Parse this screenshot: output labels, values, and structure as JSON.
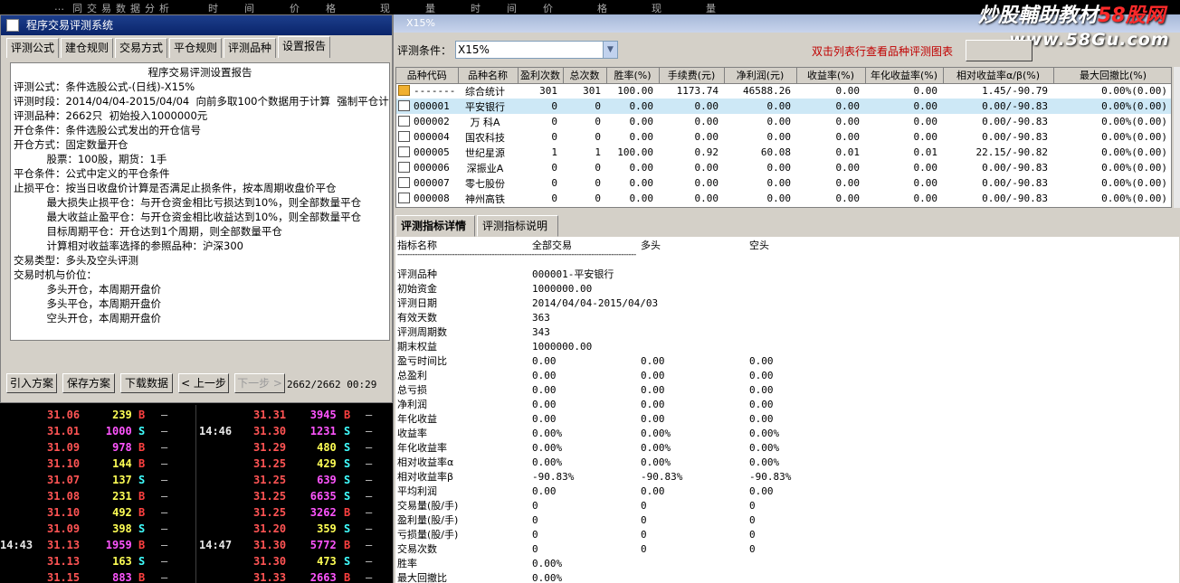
{
  "top_strip": [
    "…",
    "同",
    "交",
    "易",
    "数",
    "据",
    "分",
    "析",
    "时",
    "间",
    "价",
    "格",
    "现",
    "量",
    "时",
    "间",
    "价",
    "格",
    "现",
    "量"
  ],
  "left_dialog": {
    "title": "程序交易评测系统",
    "tabs": [
      "评测公式",
      "建仓规则",
      "交易方式",
      "平仓规则",
      "评测品种",
      "设置报告"
    ],
    "active_tab": "设置报告",
    "report_title": "程序交易评测设置报告",
    "report_lines": [
      "评测公式：条件选股公式-(日线)-X15%",
      "评测时段：2014/04/04-2015/04/04  向前多取100个数据用于计算  强制平仓计入",
      "评测品种：2662只  初始投入1000000元",
      "开仓条件：条件选股公式发出的开仓信号",
      "开仓方式：固定数量开仓",
      "          股票：100股，期货：1手",
      "平仓条件：公式中定义的平仓条件",
      "止损平仓：按当日收盘价计算是否满足止损条件，按本周期收盘价平仓",
      "          最大损失止损平仓：与开仓资金相比亏损达到10%，则全部数量平仓",
      "          最大收益止盈平仓：与开仓资金相比收益达到10%，则全部数量平仓",
      "          目标周期平仓：开仓达到1个周期，则全部数量平仓",
      "          计算相对收益率选择的参照品种：沪深300",
      "",
      "交易类型：多头及空头评测",
      "交易时机与价位：",
      "          多头开仓，本周期开盘价",
      "          多头平仓，本周期开盘价",
      "          空头开仓，本周期开盘价"
    ],
    "buttons": [
      "引入方案",
      "保存方案",
      "下载数据",
      "< 上一步",
      "下一步 >"
    ],
    "counter": "2662/2662  00:29"
  },
  "tape": {
    "times": [
      "",
      "",
      "",
      "",
      "",
      "",
      "",
      "",
      "14:43",
      "",
      ""
    ],
    "times2": [
      "",
      "14:46",
      "",
      "",
      "",
      "",
      "",
      "",
      "14:47",
      "",
      ""
    ],
    "left": [
      {
        "price": "31.06",
        "vol": "239",
        "bs": "B",
        "vc": "y"
      },
      {
        "price": "31.01",
        "vol": "1000",
        "bs": "S",
        "vc": "p"
      },
      {
        "price": "31.09",
        "vol": "978",
        "bs": "B",
        "vc": "p"
      },
      {
        "price": "31.10",
        "vol": "144",
        "bs": "B",
        "vc": "y"
      },
      {
        "price": "31.07",
        "vol": "137",
        "bs": "S",
        "vc": "y"
      },
      {
        "price": "31.08",
        "vol": "231",
        "bs": "B",
        "vc": "y"
      },
      {
        "price": "31.10",
        "vol": "492",
        "bs": "B",
        "vc": "y"
      },
      {
        "price": "31.09",
        "vol": "398",
        "bs": "S",
        "vc": "y"
      },
      {
        "price": "31.13",
        "vol": "1959",
        "bs": "B",
        "vc": "p"
      },
      {
        "price": "31.13",
        "vol": "163",
        "bs": "S",
        "vc": "y"
      },
      {
        "price": "31.15",
        "vol": "883",
        "bs": "B",
        "vc": "p"
      }
    ],
    "right": [
      {
        "price": "31.31",
        "vol": "3945",
        "bs": "B",
        "vc": "p"
      },
      {
        "price": "31.30",
        "vol": "1231",
        "bs": "S",
        "vc": "p"
      },
      {
        "price": "31.29",
        "vol": "480",
        "bs": "S",
        "vc": "y"
      },
      {
        "price": "31.25",
        "vol": "429",
        "bs": "S",
        "vc": "y"
      },
      {
        "price": "31.25",
        "vol": "639",
        "bs": "S",
        "vc": "p"
      },
      {
        "price": "31.25",
        "vol": "6635",
        "bs": "S",
        "vc": "p"
      },
      {
        "price": "31.25",
        "vol": "3262",
        "bs": "B",
        "vc": "p"
      },
      {
        "price": "31.20",
        "vol": "359",
        "bs": "S",
        "vc": "y"
      },
      {
        "price": "31.30",
        "vol": "5772",
        "bs": "B",
        "vc": "p"
      },
      {
        "price": "31.30",
        "vol": "473",
        "bs": "S",
        "vc": "y"
      },
      {
        "price": "31.33",
        "vol": "2663",
        "bs": "B",
        "vc": "p"
      }
    ],
    "dash": "—"
  },
  "right_window": {
    "title": "X15%",
    "watermark_line1": "炒股輔助教材",
    "watermark_brand": "58股网",
    "watermark_line2": "www.58Gu.com",
    "cond_label": "评测条件：",
    "cond_value": "X15%",
    "hint": "双击列表行查看品种评测图表",
    "columns": [
      "品种代码",
      "品种名称",
      "盈利次数",
      "总次数",
      "胜率(%)",
      "手续费(元)",
      "净利润(元)",
      "收益率(%)",
      "年化收益率(%)",
      "相对收益率α/β(%)",
      "最大回撤比(%)"
    ],
    "rows": [
      [
        "-------",
        "综合统计",
        "301",
        "301",
        "100.00",
        "1173.74",
        "46588.26",
        "0.00",
        "0.00",
        "1.45/-90.79",
        "0.00%(0.00)"
      ],
      [
        "000001",
        "平安银行",
        "0",
        "0",
        "0.00",
        "0.00",
        "0.00",
        "0.00",
        "0.00",
        "0.00/-90.83",
        "0.00%(0.00)"
      ],
      [
        "000002",
        "万  科A",
        "0",
        "0",
        "0.00",
        "0.00",
        "0.00",
        "0.00",
        "0.00",
        "0.00/-90.83",
        "0.00%(0.00)"
      ],
      [
        "000004",
        "国农科技",
        "0",
        "0",
        "0.00",
        "0.00",
        "0.00",
        "0.00",
        "0.00",
        "0.00/-90.83",
        "0.00%(0.00)"
      ],
      [
        "000005",
        "世纪星源",
        "1",
        "1",
        "100.00",
        "0.92",
        "60.08",
        "0.01",
        "0.01",
        "22.15/-90.82",
        "0.00%(0.00)"
      ],
      [
        "000006",
        "深振业A",
        "0",
        "0",
        "0.00",
        "0.00",
        "0.00",
        "0.00",
        "0.00",
        "0.00/-90.83",
        "0.00%(0.00)"
      ],
      [
        "000007",
        "零七股份",
        "0",
        "0",
        "0.00",
        "0.00",
        "0.00",
        "0.00",
        "0.00",
        "0.00/-90.83",
        "0.00%(0.00)"
      ],
      [
        "000008",
        "神州高铁",
        "0",
        "0",
        "0.00",
        "0.00",
        "0.00",
        "0.00",
        "0.00",
        "0.00/-90.83",
        "0.00%(0.00)"
      ]
    ],
    "selected_row": 1,
    "lower_tabs": [
      "评测指标详情",
      "评测指标说明"
    ],
    "detail_header": [
      "指标名称",
      "全部交易",
      "多头",
      "空头"
    ],
    "detail_rule": "------------------------------------------------------------------------------------------------",
    "detail_rows": [
      [
        "评测品种",
        "000001-平安银行",
        "",
        ""
      ],
      [
        "初始资金",
        "1000000.00",
        "",
        ""
      ],
      [
        "评测日期",
        "2014/04/04-2015/04/03",
        "",
        ""
      ],
      [
        "有效天数",
        "363",
        "",
        ""
      ],
      [
        "评测周期数",
        "343",
        "",
        ""
      ],
      [
        "期末权益",
        "1000000.00",
        "",
        ""
      ],
      [
        "盈亏时间比",
        "0.00",
        "0.00",
        "0.00"
      ],
      [
        "总盈利",
        "0.00",
        "0.00",
        "0.00"
      ],
      [
        "总亏损",
        "0.00",
        "0.00",
        "0.00"
      ],
      [
        "净利润",
        "0.00",
        "0.00",
        "0.00"
      ],
      [
        "年化收益",
        "0.00",
        "0.00",
        "0.00"
      ],
      [
        "收益率",
        "0.00%",
        "0.00%",
        "0.00%"
      ],
      [
        "年化收益率",
        "0.00%",
        "0.00%",
        "0.00%"
      ],
      [
        "相对收益率α",
        "0.00%",
        "0.00%",
        "0.00%"
      ],
      [
        "相对收益率β",
        "-90.83%",
        "-90.83%",
        "-90.83%"
      ],
      [
        "平均利润",
        "0.00",
        "0.00",
        "0.00"
      ],
      [
        "交易量(股/手)",
        "0",
        "0",
        "0"
      ],
      [
        "盈利量(股/手)",
        "0",
        "0",
        "0"
      ],
      [
        "亏损量(股/手)",
        "0",
        "0",
        "0"
      ],
      [
        "交易次数",
        "0",
        "0",
        "0"
      ],
      [
        "胜率",
        "0.00%",
        "",
        ""
      ],
      [
        "最大回撤比",
        "0.00%",
        "",
        ""
      ]
    ]
  }
}
